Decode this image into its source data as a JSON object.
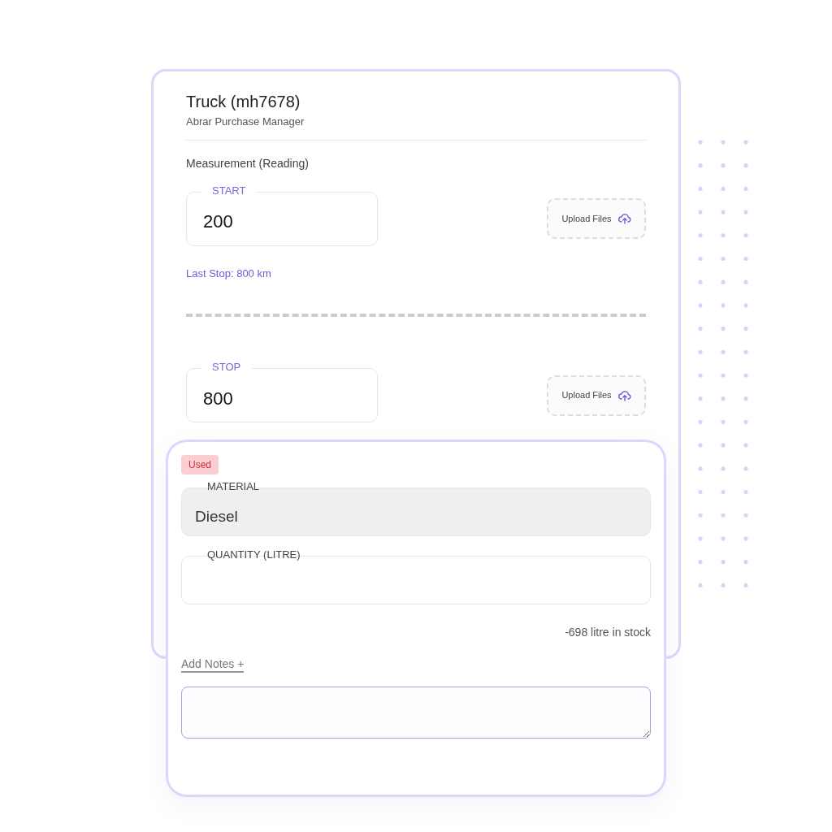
{
  "header": {
    "title": "Truck (mh7678)",
    "subtitle": "Abrar Purchase Manager"
  },
  "section_label": "Measurement (Reading)",
  "readings": [
    {
      "label": "START",
      "value": "200",
      "upload_button": "Upload Files",
      "note": "Last Stop: 800 km"
    },
    {
      "label": "STOP",
      "value": "800",
      "upload_button": "Upload Files"
    }
  ],
  "usage": {
    "badge": "Used",
    "fields": [
      {
        "label": "MATERIAL",
        "value": "Diesel",
        "disabled": true
      },
      {
        "label": "QUANTITY (LITRE)",
        "disabled": false
      }
    ],
    "stock_note": "-698 litre in stock",
    "add_notes_link": "Add Notes +"
  }
}
